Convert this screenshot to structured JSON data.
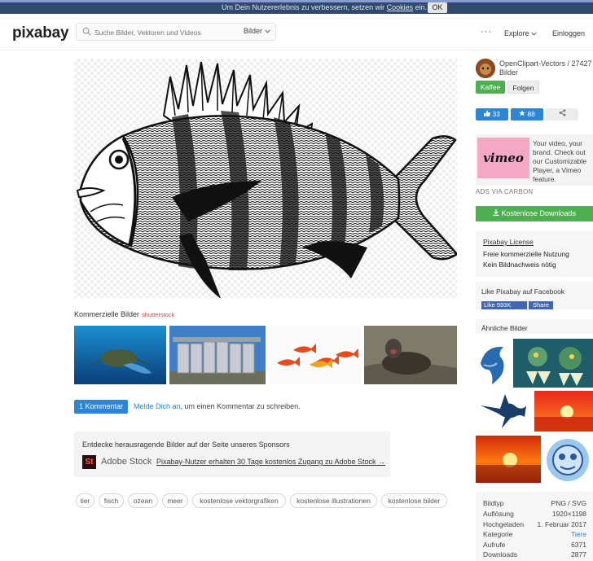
{
  "cookie_bar": {
    "text_before": "Um Dein Nutzererlebnis zu verbessern, setzen wir ",
    "text_link": "Cookies",
    "text_after": " ein.",
    "ok_label": "OK"
  },
  "header": {
    "logo": "pixabay",
    "search_placeholder": "Suche Bilder, Vektoren und Videos",
    "search_type": "Bilder",
    "more": "···",
    "explore": "Explore",
    "login": "Einloggen"
  },
  "commercial": {
    "label": "Kommerzielle Bilder",
    "provider": "shutterstock"
  },
  "comment": {
    "button": "1 Kommentar",
    "link": "Melde Dich an",
    "text": ", um einen Kommentar zu schreiben."
  },
  "sponsor": {
    "heading": "Entdecke herausragende Bilder auf der Seite unseres Sponsors",
    "logo_letters": "St",
    "brand": "Adobe Stock",
    "link": "Pixabay-Nutzer erhalten 30 Tage kostenlos Zugang zu Adobe Stock →"
  },
  "tags": [
    "tier",
    "fisch",
    "ozean",
    "meer",
    "kostenlose vektorgrafiken",
    "kostenlose illustrationen",
    "kostenlose bilder"
  ],
  "sidebar": {
    "author": "OpenClipart-Vectors / 27427 Bilder",
    "coffee": "Kaffee",
    "follow": "Folgen",
    "likes": "33",
    "favorites": "88",
    "ad_brand": "vimeo",
    "ad_text": "Your video, your brand. Check out our Customizable Player, a Vimeo feature.",
    "ad_via": "ADS VIA CARBON",
    "download": "Kostenlose Downloads",
    "license_title": "Pixabay License",
    "license_line1": "Freie kommerzielle Nutzung",
    "license_line2": "Kein Bildnachweis nötig",
    "fb_heading": "Like Pixabay auf Facebook",
    "fb_like": "Like 593K",
    "fb_share": "Share",
    "similar_heading": "Ähnliche Bilder"
  },
  "details": [
    {
      "key": "Bildtyp",
      "value": "PNG / SVG"
    },
    {
      "key": "Auflösung",
      "value": "1920×1198"
    },
    {
      "key": "Hochgeladen",
      "value": "1. Februar 2017"
    },
    {
      "key": "Kategorie",
      "value": "Tiere"
    },
    {
      "key": "Aufrufe",
      "value": "6371"
    },
    {
      "key": "Downloads",
      "value": "2877"
    }
  ]
}
